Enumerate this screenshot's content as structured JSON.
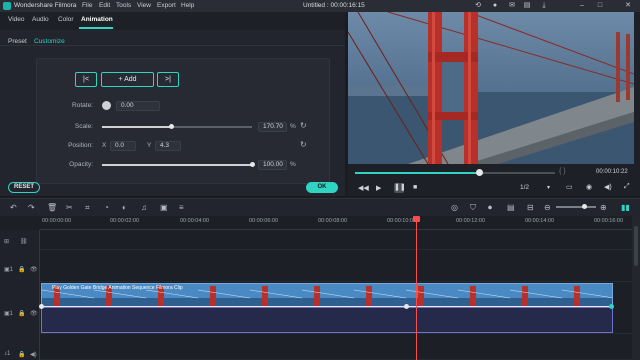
{
  "app": {
    "name": "Wondershare Filmora",
    "title": "Untitled : 00:00:16:15"
  },
  "menu": [
    "File",
    "Edit",
    "Tools",
    "View",
    "Export",
    "Help"
  ],
  "panel_tabs": [
    "Video",
    "Audio",
    "Color",
    "Animation"
  ],
  "panel_subtabs": [
    "Preset",
    "Customize"
  ],
  "keyframe": {
    "prev": "|<",
    "add": "+ Add",
    "next": ">|"
  },
  "properties": {
    "rotate": {
      "label": "Rotate:",
      "value": "0.00"
    },
    "scale": {
      "label": "Scale:",
      "value": "170.70",
      "unit": "%",
      "level": 0.46
    },
    "position": {
      "label": "Position:",
      "x_label": "X",
      "x": "0.0",
      "y_label": "Y",
      "y": "4.3"
    },
    "opacity": {
      "label": "Opacity:",
      "value": "100.00",
      "unit": "%",
      "level": 1.0
    }
  },
  "buttons": {
    "reset": "RESET",
    "ok": "OK"
  },
  "preview": {
    "progress": 0.62,
    "brackets": "{    }",
    "timecode": "00:00:10:22",
    "quality": "1/2"
  },
  "ruler": [
    "00:00:00:00",
    "00:00:02:00",
    "00:00:04:00",
    "00:00:06:00",
    "00:00:08:00",
    "00:00:10:00",
    "00:00:12:00",
    "00:00:14:00",
    "00:00:16:00"
  ],
  "clip": {
    "title": "Play Golden Gate Bridge Animation Sequence Filmora Clip",
    "playhead_time": "00:00:11:00"
  },
  "colors": {
    "accent": "#2fd4c2",
    "playhead": "#ff4b4b",
    "clip": "#3c7eb3"
  },
  "icons": [
    "undo-icon",
    "redo-icon",
    "delete-icon",
    "cut-icon",
    "crop-icon",
    "speed-icon",
    "color-icon",
    "audio-icon",
    "adjust-icon",
    "play-icon",
    "stop-icon",
    "snapshot-icon",
    "volume-icon",
    "fullscreen-icon"
  ]
}
